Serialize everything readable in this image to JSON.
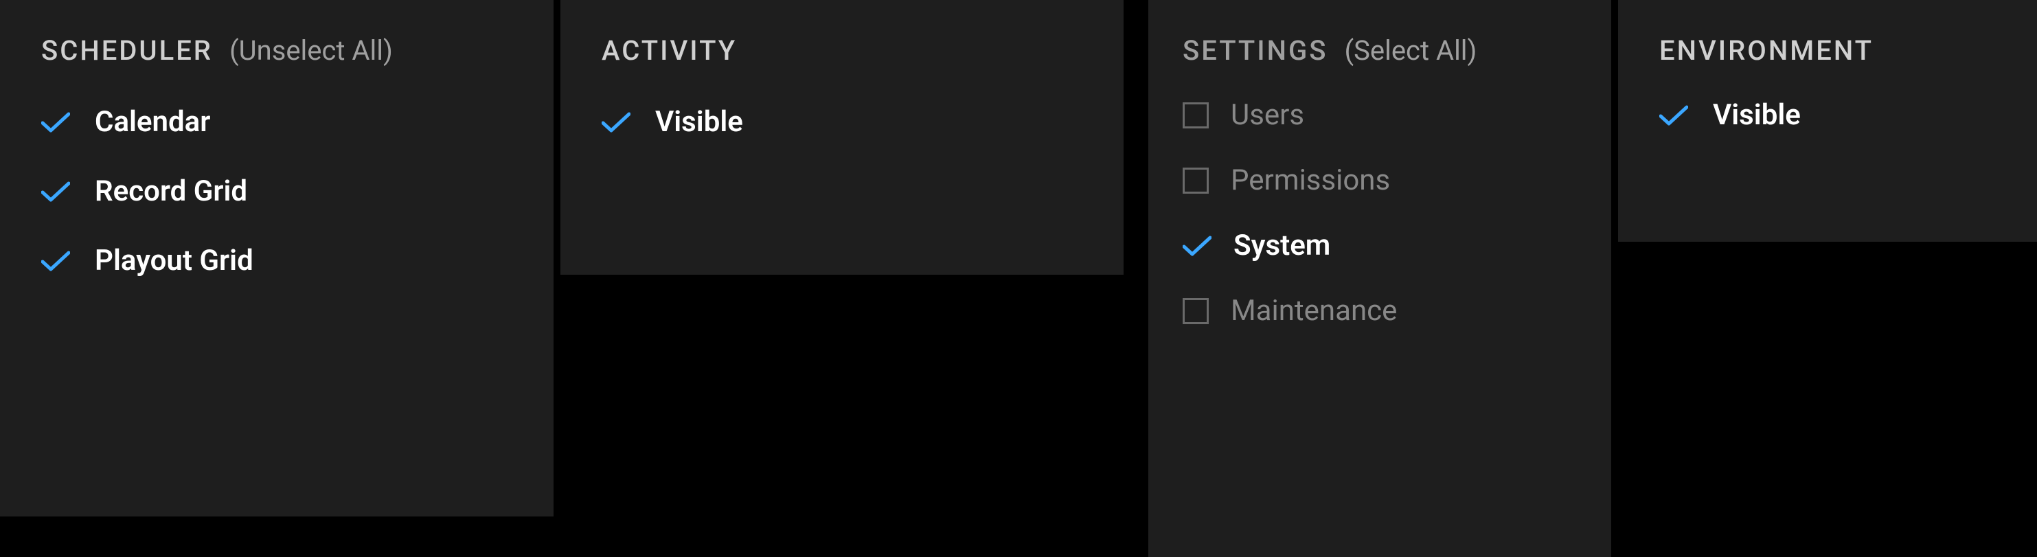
{
  "accent_color": "#3ba7ff",
  "panels": {
    "scheduler": {
      "title": "SCHEDULER",
      "action": "(Unselect All)",
      "items": [
        {
          "label": "Calendar",
          "checked": true
        },
        {
          "label": "Record Grid",
          "checked": true
        },
        {
          "label": "Playout Grid",
          "checked": true
        }
      ]
    },
    "activity": {
      "title": "ACTIVITY",
      "items": [
        {
          "label": "Visible",
          "checked": true
        }
      ]
    },
    "settings": {
      "title": "SETTINGS",
      "action": "(Select All)",
      "items": [
        {
          "label": "Users",
          "checked": false
        },
        {
          "label": "Permissions",
          "checked": false
        },
        {
          "label": "System",
          "checked": true
        },
        {
          "label": "Maintenance",
          "checked": false
        }
      ]
    },
    "environment": {
      "title": "ENVIRONMENT",
      "items": [
        {
          "label": "Visible",
          "checked": true
        }
      ]
    }
  }
}
